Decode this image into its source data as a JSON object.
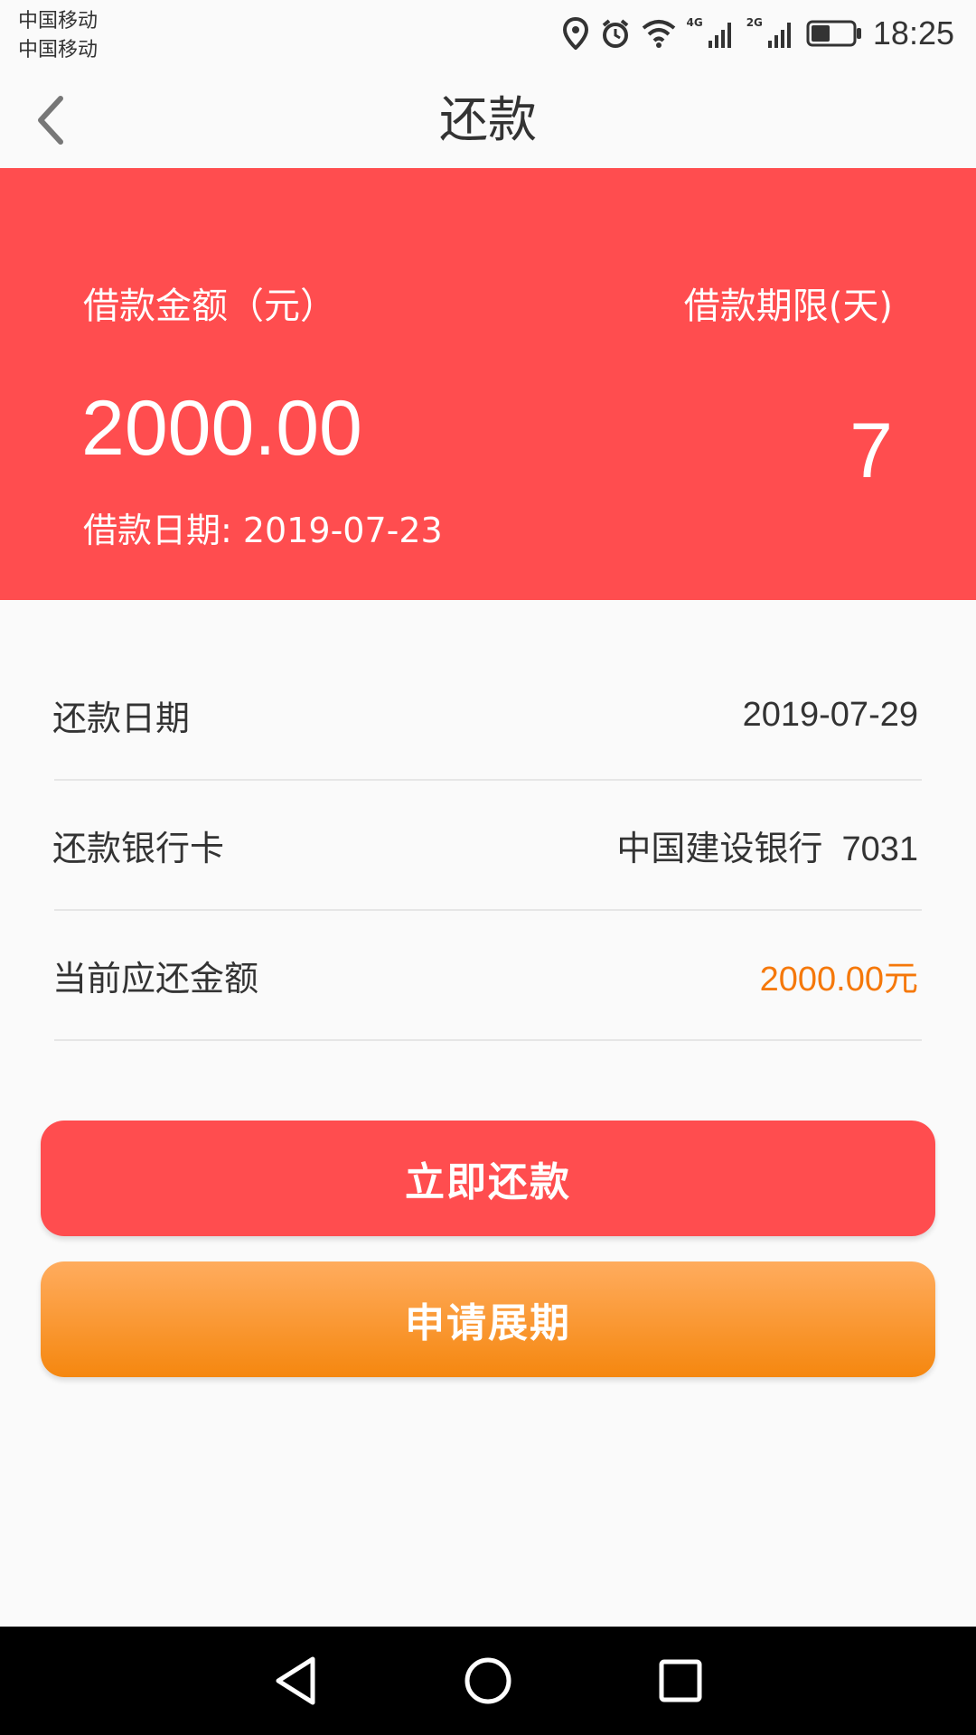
{
  "status_bar": {
    "carrier_1": "中国移动",
    "carrier_2": "中国移动",
    "net_1": "4G",
    "net_2": "2G",
    "time": "18:25",
    "battery_level": 0.45
  },
  "header": {
    "title": "还款"
  },
  "summary": {
    "loan_amount_label": "借款金额（元）",
    "loan_amount": "2000.00",
    "loan_term_label": "借款期限(天)",
    "loan_term": "7",
    "loan_date": "借款日期: 2019-07-23"
  },
  "details": [
    {
      "label": "还款日期",
      "value": "2019-07-29"
    },
    {
      "label": "还款银行卡",
      "value": "中国建设银行  7031"
    },
    {
      "label": "当前应还金额",
      "value": "2000.00元"
    }
  ],
  "buttons": {
    "repay": "立即还款",
    "extend": "申请展期"
  },
  "colors": {
    "primary_red": "#ff4d4f",
    "accent_orange": "#f5780a"
  },
  "icons": {
    "back": "chevron-left-icon",
    "location": "location-icon",
    "alarm": "alarm-icon",
    "wifi": "wifi-icon",
    "signal": "signal-icon",
    "battery": "battery-icon",
    "nav_back": "triangle-back-icon",
    "nav_home": "circle-home-icon",
    "nav_recent": "square-recent-icon"
  }
}
